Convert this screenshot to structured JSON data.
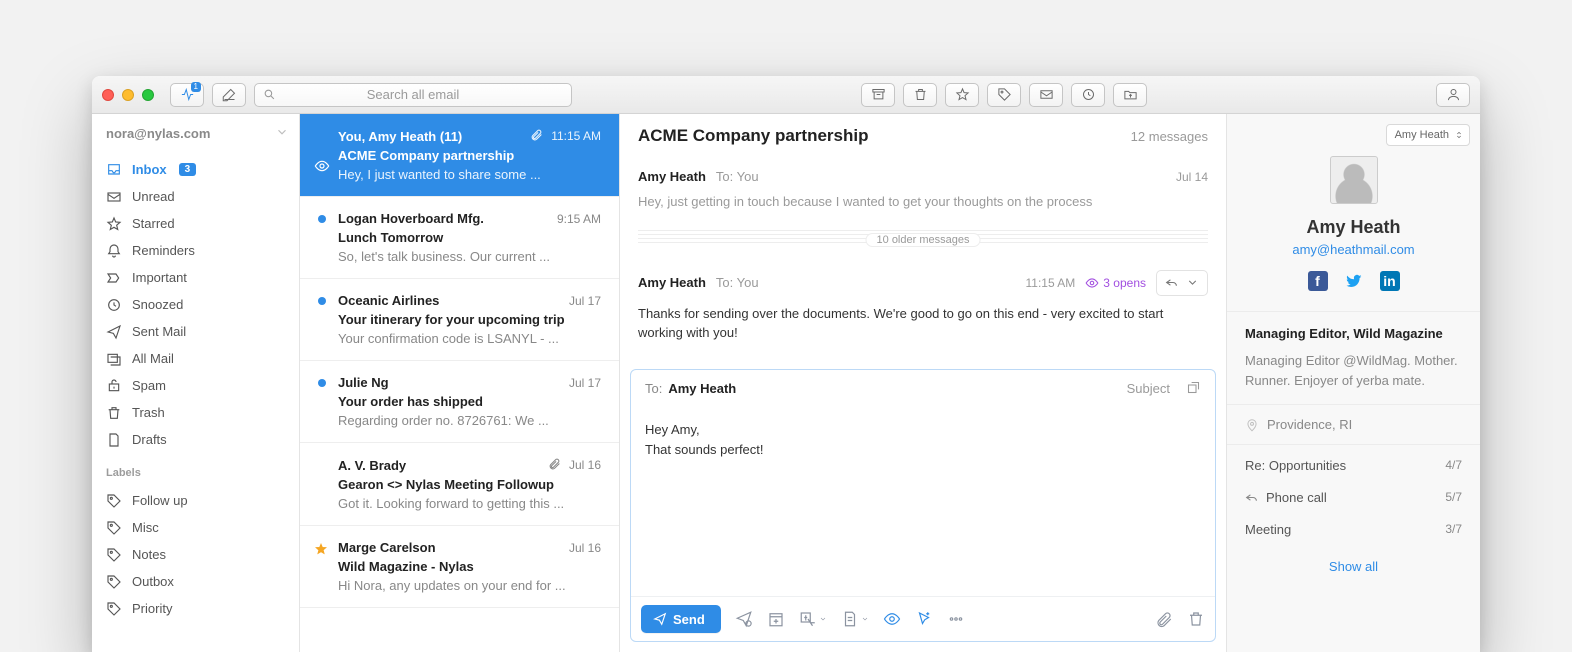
{
  "toolbar": {
    "activity_badge": "1",
    "search_placeholder": "Search all email"
  },
  "account": {
    "email": "nora@nylas.com"
  },
  "sidebar": {
    "folders": [
      {
        "id": "inbox",
        "label": "Inbox",
        "count": "3",
        "active": true
      },
      {
        "id": "unread",
        "label": "Unread"
      },
      {
        "id": "starred",
        "label": "Starred"
      },
      {
        "id": "reminders",
        "label": "Reminders"
      },
      {
        "id": "important",
        "label": "Important"
      },
      {
        "id": "snoozed",
        "label": "Snoozed"
      },
      {
        "id": "sent",
        "label": "Sent Mail"
      },
      {
        "id": "allmail",
        "label": "All Mail"
      },
      {
        "id": "spam",
        "label": "Spam"
      },
      {
        "id": "trash",
        "label": "Trash"
      },
      {
        "id": "drafts",
        "label": "Drafts"
      }
    ],
    "labels_heading": "Labels",
    "labels": [
      {
        "label": "Follow up"
      },
      {
        "label": "Misc"
      },
      {
        "label": "Notes"
      },
      {
        "label": "Outbox"
      },
      {
        "label": "Priority"
      }
    ]
  },
  "threads": [
    {
      "from": "You, Amy Heath (11)",
      "time": "11:15 AM",
      "subject": "ACME Company partnership",
      "snippet": "Hey, I just wanted to share some ...",
      "selected": true,
      "attachment": true,
      "tracked": true
    },
    {
      "from": "Logan Hoverboard Mfg.",
      "time": "9:15 AM",
      "subject": "Lunch Tomorrow",
      "snippet": "So, let's talk business. Our current ...",
      "unread": true
    },
    {
      "from": "Oceanic Airlines",
      "time": "Jul 17",
      "subject": "Your itinerary for your upcoming trip",
      "snippet": "Your confirmation code is LSANYL - ...",
      "unread": true
    },
    {
      "from": "Julie Ng",
      "time": "Jul 17",
      "subject": "Your order has shipped",
      "snippet": "Regarding order no. 8726761: We ...",
      "unread": true
    },
    {
      "from": "A. V. Brady",
      "time": "Jul 16",
      "subject": "Gearon <> Nylas Meeting Followup",
      "snippet": "Got it. Looking forward to getting this ...",
      "attachment": true
    },
    {
      "from": "Marge Carelson",
      "time": "Jul 16",
      "subject": "Wild Magazine - Nylas",
      "snippet": "Hi Nora, any updates on your end for ...",
      "starred": true
    }
  ],
  "conversation": {
    "subject": "ACME Company partnership",
    "count_label": "12 messages",
    "older_label": "10 older messages",
    "msg1": {
      "from": "Amy Heath",
      "to_label": "To:",
      "to_value": "You",
      "date": "Jul 14",
      "body": "Hey, just getting in touch because I wanted to get your thoughts on the process"
    },
    "msg2": {
      "from": "Amy Heath",
      "to_label": "To:",
      "to_value": "You",
      "time": "11:15 AM",
      "opens_label": "3 opens",
      "body": "Thanks for sending over the documents. We're good to go on this end - very excited to start working with you!"
    }
  },
  "composer": {
    "to_label": "To:",
    "to_name": "Amy Heath",
    "subject_placeholder": "Subject",
    "body_line1": "Hey Amy,",
    "body_line2": "That sounds perfect!",
    "send_label": "Send"
  },
  "profile": {
    "picker_label": "Amy Heath",
    "name": "Amy Heath",
    "email": "amy@heathmail.com",
    "job": "Managing Editor, Wild Magazine",
    "bio": "Managing Editor @WildMag. Mother. Runner. Enjoyer of yerba mate.",
    "location": "Providence, RI",
    "related": [
      {
        "label": "Re: Opportunities",
        "count": "4/7"
      },
      {
        "label": "Phone call",
        "count": "5/7",
        "reply": true
      },
      {
        "label": "Meeting",
        "count": "3/7"
      }
    ],
    "show_all": "Show all"
  }
}
